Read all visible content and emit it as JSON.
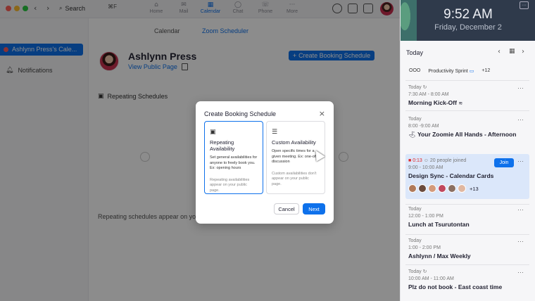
{
  "top_bar": {
    "search_label": "Search",
    "search_shortcut": "⌘F",
    "tabs": [
      {
        "label": "Home",
        "icon": "home-icon"
      },
      {
        "label": "Mail",
        "icon": "mail-icon"
      },
      {
        "label": "Calendar",
        "icon": "calendar-icon"
      },
      {
        "label": "Chat",
        "icon": "chat-icon"
      },
      {
        "label": "Phone",
        "icon": "phone-icon"
      },
      {
        "label": "More",
        "icon": "more-icon"
      }
    ]
  },
  "sidebar": {
    "calendar_item": "Ashlynn Press's Cale...",
    "notifications": "Notifications"
  },
  "main": {
    "subtabs": [
      "Calendar",
      "Zoom Scheduler"
    ],
    "profile_name": "Ashlynn Press",
    "view_public_page": "View Public Page",
    "create_button": "Create Booking Schedule",
    "repeating_title": "Repeating Schedules",
    "empty_text": "Repeating schedules appear on you"
  },
  "modal": {
    "title": "Create Booking Schedule",
    "options": [
      {
        "title": "Repeating Availability",
        "description": "Set general availabilities for anyone to freely book you. Ex: opening hours",
        "note": "Repeating availabilities appear on your public page."
      },
      {
        "title": "Custom Availability",
        "description": "Open specific times for a given meeting. Ex: one-off discussion",
        "note": "Custom availabilities don't appear on your public page."
      }
    ],
    "cancel": "Cancel",
    "next": "Next"
  },
  "right_panel": {
    "clock_time": "9:52 AM",
    "clock_date": "Friday, December 2",
    "today_label": "Today",
    "all_day": [
      "OOO",
      "Productivity Sprint",
      "+12"
    ],
    "events": [
      {
        "when": "Today",
        "time": "7:30 AM - 8:00 AM",
        "title": "Morning Kick-Off"
      },
      {
        "when": "Today",
        "time": "8:00 -9:00 AM",
        "title": "Your Zoomie All Hands - Afternoon"
      },
      {
        "when": "0:13",
        "joined": "20 people joined",
        "time": "9:00 - 10:00 AM",
        "title": "Design Sync - Calendar Cards",
        "join": "Join",
        "more_avatars": "+13"
      },
      {
        "when": "Today",
        "time": "12:00 - 1:00 PM",
        "title": "Lunch at Tsurutontan"
      },
      {
        "when": "Today",
        "time": "1:00 - 2:00 PM",
        "title": "Ashlynn / Max Weekly"
      },
      {
        "when": "Today",
        "time": "10:00 AM - 11:00 AM",
        "title": "Plz do not book - East coast time"
      }
    ]
  },
  "colors": {
    "accent": "#0e71eb",
    "overlay": "#000000",
    "live": "#e02828"
  }
}
